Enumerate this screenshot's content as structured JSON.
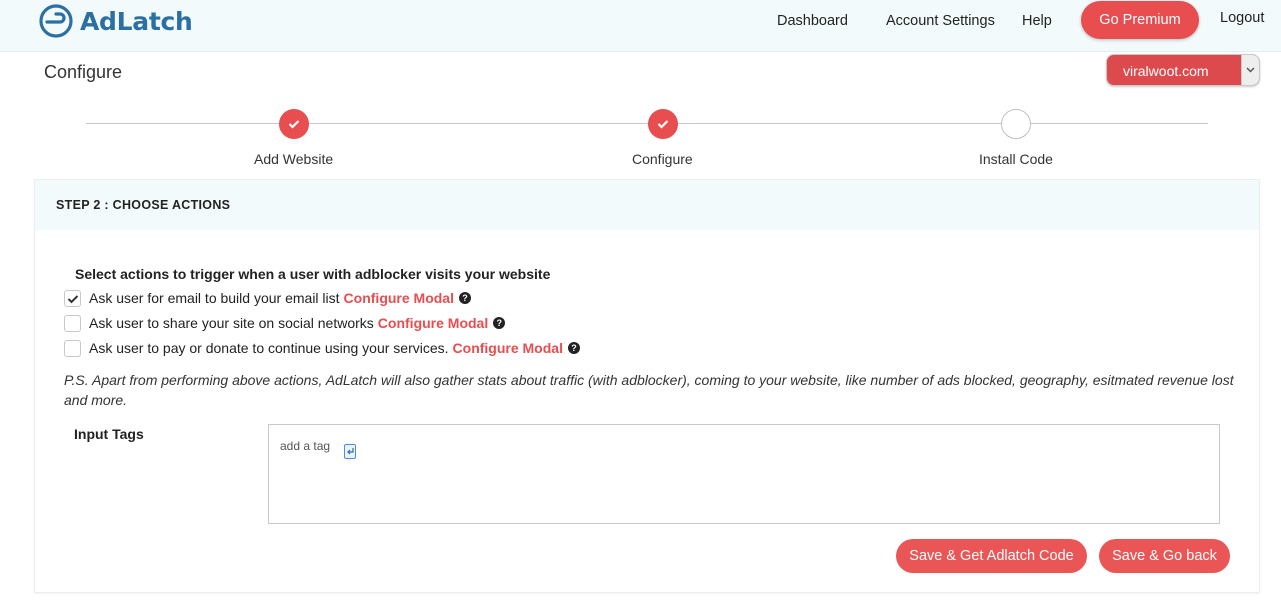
{
  "header": {
    "brand": "AdLatch",
    "nav": {
      "dashboard": "Dashboard",
      "account_settings": "Account Settings",
      "help": "Help",
      "go_premium": "Go Premium",
      "logout": "Logout"
    }
  },
  "page": {
    "title": "Configure",
    "site_selector": {
      "selected": "viralwoot.com"
    }
  },
  "stepper": {
    "steps": [
      {
        "label": "Add Website",
        "status": "complete"
      },
      {
        "label": "Configure",
        "status": "complete"
      },
      {
        "label": "Install Code",
        "status": "pending"
      }
    ]
  },
  "card": {
    "heading": "STEP 2 : CHOOSE ACTIONS",
    "section_title": "Select actions to trigger when a user with adblocker visits your website",
    "options": [
      {
        "label": "Ask user for email to build your email list",
        "link": "Configure Modal",
        "checked": true
      },
      {
        "label": "Ask user to share your site on social networks",
        "link": "Configure Modal",
        "checked": false
      },
      {
        "label": "Ask user to pay or donate to continue using your services.",
        "link": "Configure Modal",
        "checked": false
      }
    ],
    "ps_note": "P.S. Apart from performing above actions, AdLatch will also gather stats about traffic (with adblocker), coming to your website, like number of ads blocked, geography, esitmated revenue lost and more.",
    "input_tags": {
      "label": "Input Tags",
      "placeholder": "add a tag"
    },
    "buttons": {
      "save_get_code": "Save & Get Adlatch Code",
      "save_go_back": "Save & Go back"
    }
  },
  "colors": {
    "accent": "#e84d50",
    "brand": "#2c6fa3",
    "header_bg": "#f3fafc"
  }
}
